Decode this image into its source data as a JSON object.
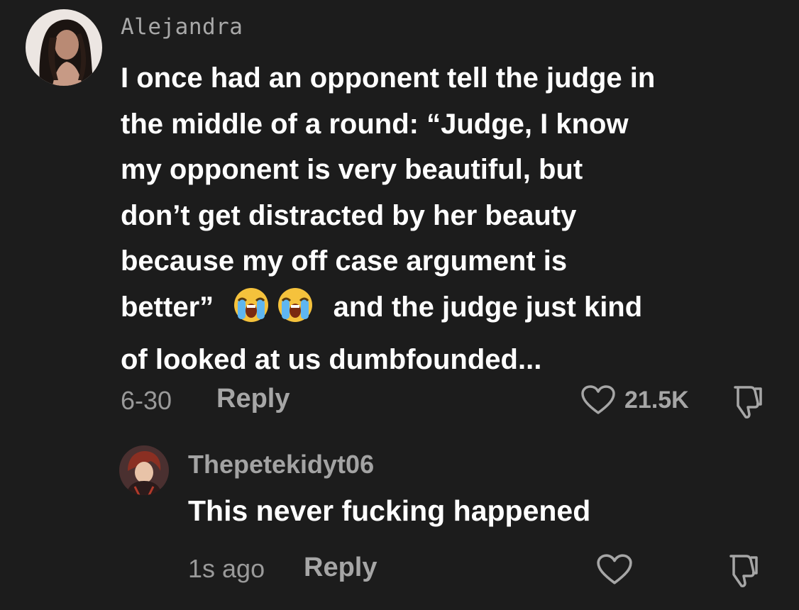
{
  "comment": {
    "username": "Alejandra",
    "text_lines": [
      "I once had an opponent tell the judge in",
      "the middle of a round: “Judge, I know",
      "my opponent is very beautiful, but",
      "don’t get distracted by her beauty",
      "because my off case argument is"
    ],
    "line6_before": "better”",
    "line6_after": "and the judge just kind",
    "line7": "of looked at us dumbfounded...",
    "emoji_icon": "loudly-crying-face-icon",
    "date": "6-30",
    "reply_label": "Reply",
    "like_count": "21.5K"
  },
  "reply": {
    "username": "Thepetekidyt06",
    "text": "This never fucking happened",
    "time": "1s ago",
    "reply_label": "Reply"
  },
  "colors": {
    "background": "#1c1c1c",
    "text": "#ffffff",
    "muted": "#a6a6a6"
  }
}
